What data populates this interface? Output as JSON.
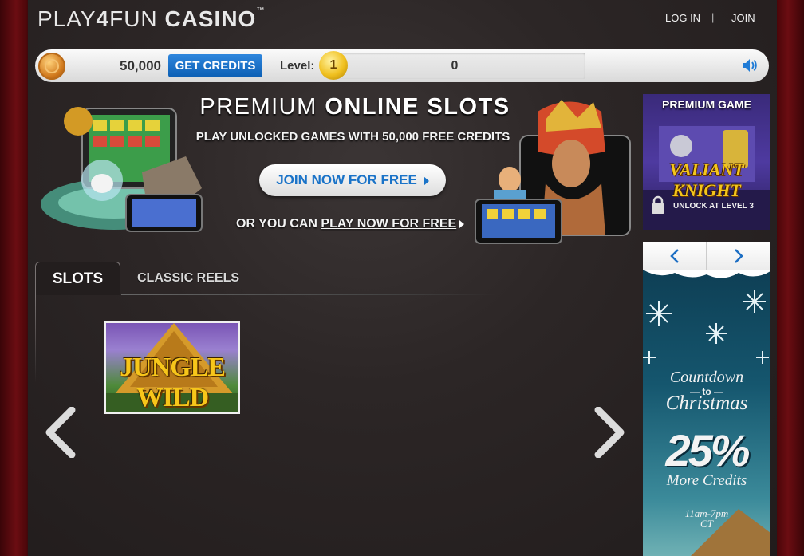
{
  "header": {
    "logo": {
      "play": "PLAY",
      "four": "4",
      "fun": "FUN",
      "casino": "CASINO",
      "tm": "™"
    },
    "login_label": "LOG IN",
    "separator": "|",
    "join_label": "JOIN"
  },
  "credit_bar": {
    "credits": "50,000",
    "get_credits_label": "GET CREDITS",
    "level_label": "Level:",
    "level_value": "1",
    "xp_value": "0"
  },
  "hero": {
    "title_light": "PREMIUM ",
    "title_bold": "ONLINE SLOTS",
    "subtitle": "PLAY UNLOCKED GAMES WITH 50,000 FREE CREDITS",
    "join_button_label": "JOIN NOW FOR FREE",
    "or_text": "OR YOU CAN ",
    "play_link_label": "PLAY NOW FOR FREE"
  },
  "tabs": [
    {
      "label": "SLOTS",
      "active": true
    },
    {
      "label": "CLASSIC REELS",
      "active": false
    }
  ],
  "games": [
    {
      "title": "JUNGLE WILD"
    }
  ],
  "sidebar": {
    "premium": {
      "title": "PREMIUM GAME",
      "game_name": "VALIANT KNIGHT",
      "lock_text": "UNLOCK AT LEVEL 3"
    },
    "promo": {
      "countdown": "Countdown",
      "to": "— to —",
      "christmas": "Christmas",
      "percent": "25%",
      "more_credits": "More Credits",
      "time": "11am-7pm",
      "tz": "CT"
    }
  },
  "colors": {
    "accent_blue": "#0c5fb4",
    "background": "#2c2626",
    "side_red": "#6b0d12"
  }
}
